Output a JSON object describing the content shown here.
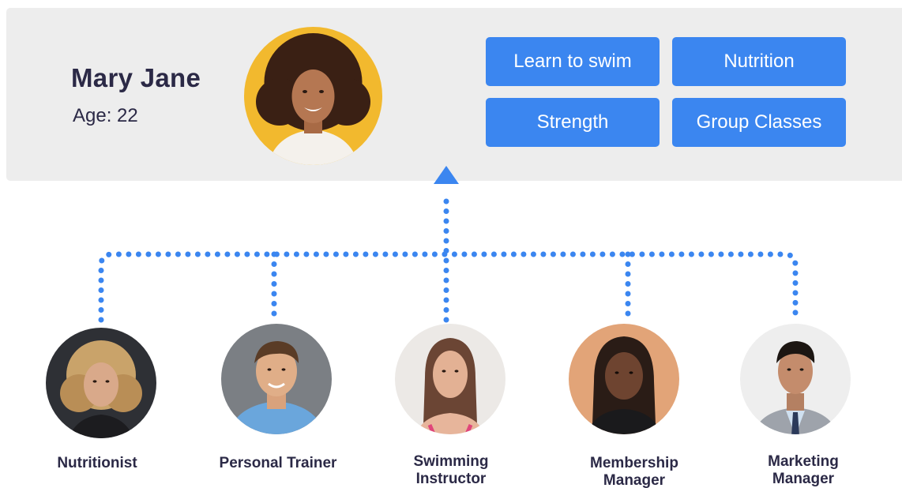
{
  "profile": {
    "name": "Mary Jane",
    "age": "Age: 22"
  },
  "interests": [
    {
      "label": "Learn to swim"
    },
    {
      "label": "Nutrition"
    },
    {
      "label": "Strength"
    },
    {
      "label": "Group Classes"
    }
  ],
  "staff": [
    {
      "role": "Nutritionist"
    },
    {
      "role": "Personal Trainer"
    },
    {
      "role": "Swimming Instructor"
    },
    {
      "role": "Membership Manager"
    },
    {
      "role": "Marketing Manager"
    }
  ],
  "colors": {
    "accent": "#3b86f0",
    "card_bg": "#ededed",
    "text_dark": "#2b2946"
  }
}
